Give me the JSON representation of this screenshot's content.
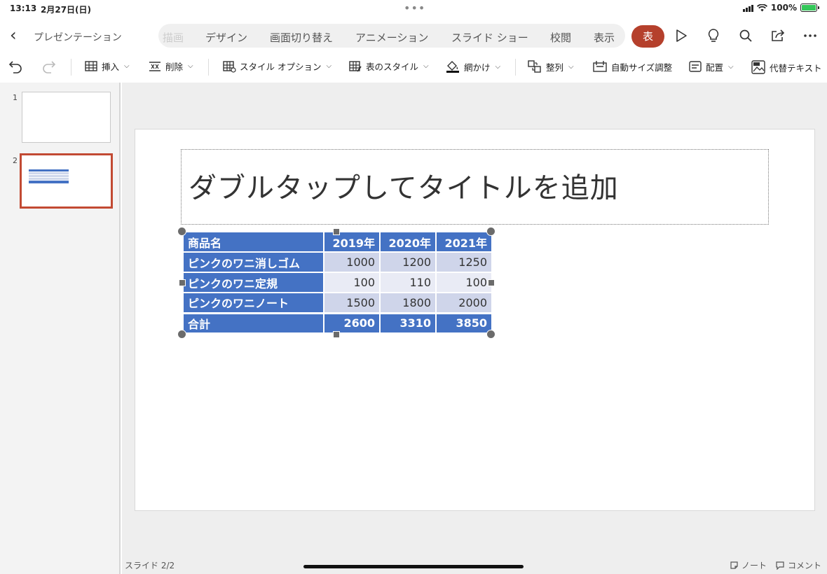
{
  "status_bar": {
    "time": "13:13",
    "date": "2月27日(日)",
    "battery": "100%"
  },
  "header": {
    "back_icon": "chevron-left-icon",
    "doc_title": "プレゼンテーション",
    "tabs": [
      {
        "label": "描画",
        "faded": true
      },
      {
        "label": "デザイン"
      },
      {
        "label": "画面切り替え"
      },
      {
        "label": "アニメーション"
      },
      {
        "label": "スライド ショー"
      },
      {
        "label": "校閲"
      },
      {
        "label": "表示"
      }
    ],
    "active_tab": "表",
    "icons": [
      "play-icon",
      "lightbulb-icon",
      "search-icon",
      "share-icon",
      "more-icon"
    ]
  },
  "toolbar": {
    "insert": "挿入",
    "delete": "削除",
    "style_options": "スタイル オプション",
    "table_styles": "表のスタイル",
    "shading": "網かけ",
    "arrange": "整列",
    "autofit": "自動サイズ調整",
    "align": "配置",
    "alt_text": "代替テキスト"
  },
  "thumbnails": [
    {
      "number": "1"
    },
    {
      "number": "2",
      "selected": true
    }
  ],
  "slide": {
    "title_placeholder": "ダブルタップしてタイトルを追加",
    "table": {
      "headers": [
        "商品名",
        "2019年",
        "2020年",
        "2021年"
      ],
      "rows": [
        [
          "ピンクのワニ消しゴム",
          "1000",
          "1200",
          "1250"
        ],
        [
          "ピンクのワニ定規",
          "100",
          "110",
          "100"
        ],
        [
          "ピンクのワニノート",
          "1500",
          "1800",
          "2000"
        ]
      ],
      "total": [
        "合計",
        "2600",
        "3310",
        "3850"
      ]
    }
  },
  "footer": {
    "slide_counter": "スライド 2/2",
    "notes": "ノート",
    "comments": "コメント"
  },
  "colors": {
    "accent": "#b5402c",
    "table_header": "#4472c4",
    "band_dark": "#cfd5ea",
    "band_light": "#e9ebf5"
  }
}
